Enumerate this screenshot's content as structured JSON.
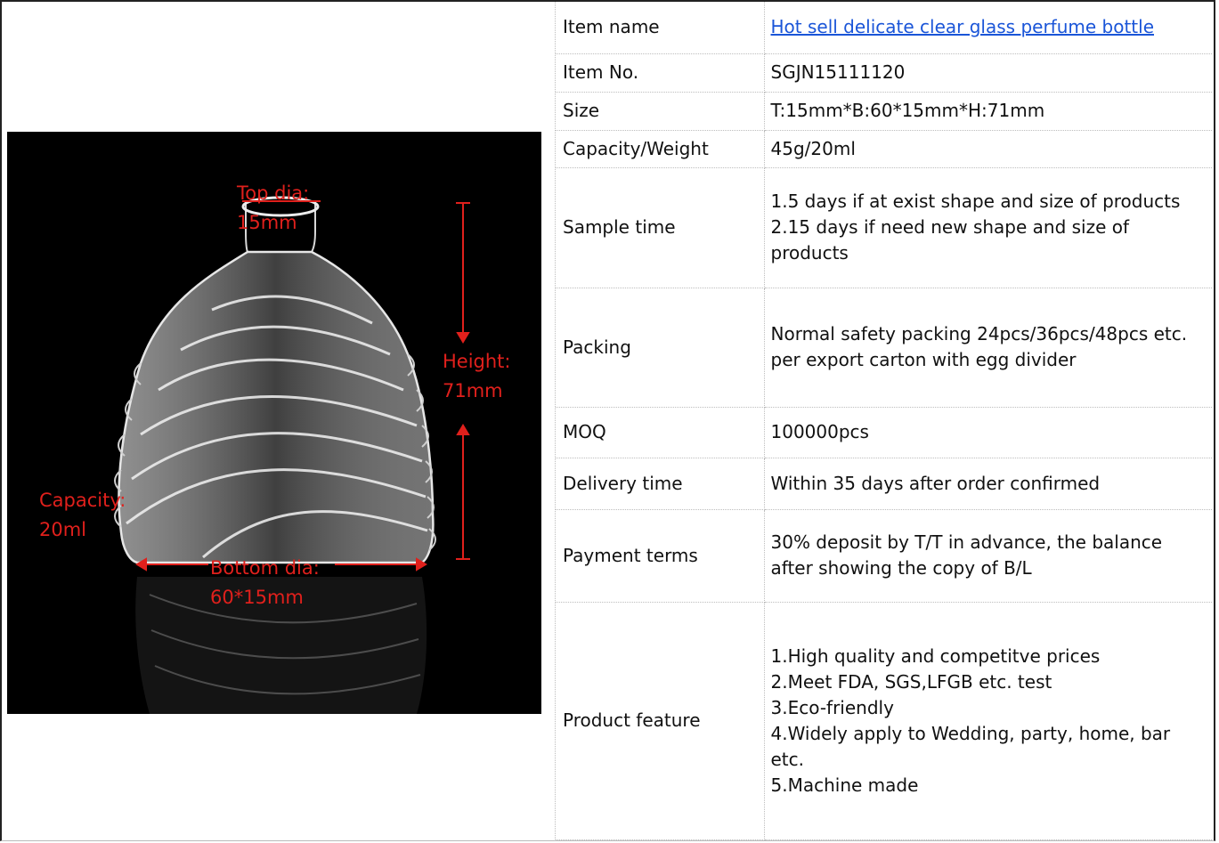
{
  "product_image": {
    "alt_icon": "perfume-bottle-image",
    "annotations": {
      "top_dia": [
        "Top dia:",
        "15mm"
      ],
      "height": [
        "Height:",
        "71mm"
      ],
      "capacity": [
        "Capacity:",
        "20ml"
      ],
      "bottom_dia": [
        "Bottom dia:",
        "60*15mm"
      ]
    },
    "colors": {
      "background": "#000000",
      "annotation": "#e0201c"
    }
  },
  "specs": [
    {
      "key": "Item name",
      "value": [
        "Hot sell delicate clear glass perfume bottle"
      ]
    },
    {
      "key": "Item No.",
      "value": [
        "SGJN15111120"
      ]
    },
    {
      "key": "Size",
      "value": [
        "T:15mm*B:60*15mm*H:71mm"
      ]
    },
    {
      "key": "Capacity/Weight",
      "value": [
        "45g/20ml"
      ]
    },
    {
      "key": "Sample time",
      "value": [
        "1.5 days if at exist shape and size of products",
        "2.15 days if need new shape and size of products"
      ]
    },
    {
      "key": "Packing",
      "value": [
        "Normal safety packing 24pcs/36pcs/48pcs etc. per export carton with egg divider"
      ]
    },
    {
      "key": "MOQ",
      "value": [
        "100000pcs"
      ]
    },
    {
      "key": "Delivery time",
      "value": [
        "Within 35 days after order confirmed"
      ]
    },
    {
      "key": "Payment terms",
      "value": [
        "30% deposit by T/T in advance, the balance after showing the copy of B/L"
      ]
    },
    {
      "key": "Product feature",
      "value": [
        "1.High quality and competitve prices",
        "2.Meet FDA, SGS,LFGB etc. test",
        "3.Eco-friendly",
        "4.Widely apply to Wedding, party, home, bar etc.",
        "5.Machine made"
      ]
    }
  ],
  "link_color": "#1a55d8"
}
